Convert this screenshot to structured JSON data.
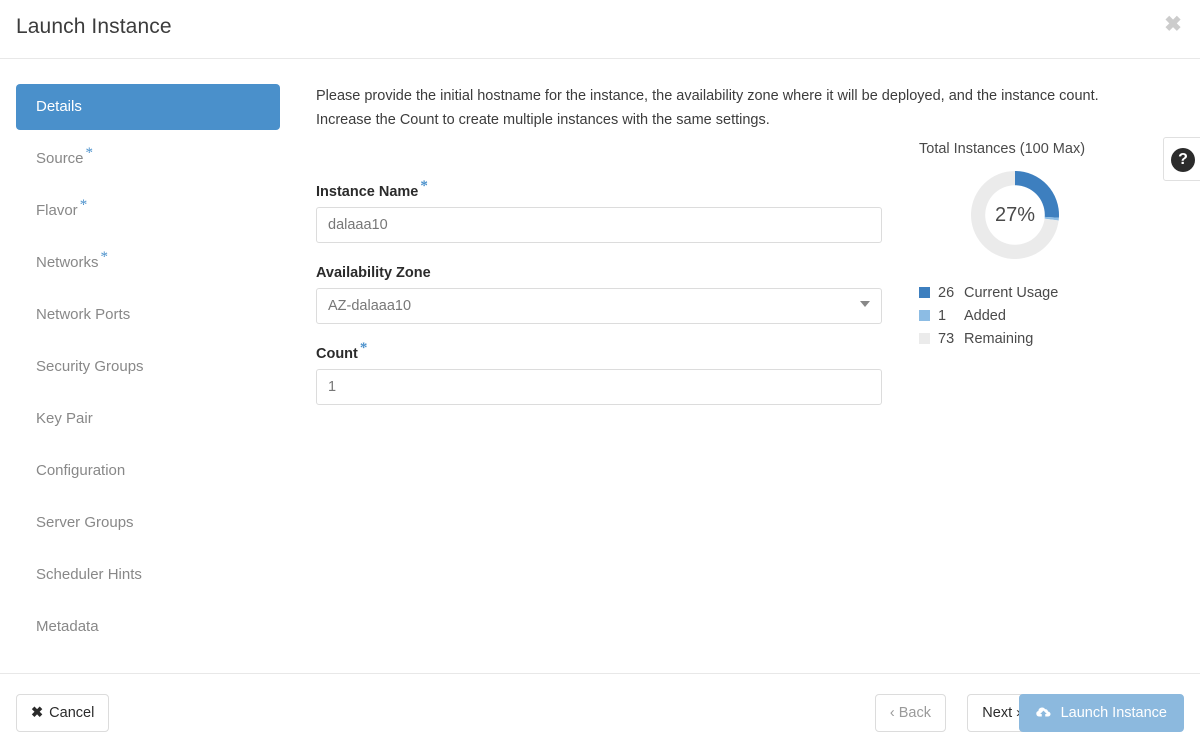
{
  "header": {
    "title": "Launch Instance",
    "close_icon": "close-icon"
  },
  "sidebar": {
    "items": [
      {
        "label": "Details",
        "required": false,
        "active": true
      },
      {
        "label": "Source",
        "required": true,
        "active": false
      },
      {
        "label": "Flavor",
        "required": true,
        "active": false
      },
      {
        "label": "Networks",
        "required": true,
        "active": false
      },
      {
        "label": "Network Ports",
        "required": false,
        "active": false
      },
      {
        "label": "Security Groups",
        "required": false,
        "active": false
      },
      {
        "label": "Key Pair",
        "required": false,
        "active": false
      },
      {
        "label": "Configuration",
        "required": false,
        "active": false
      },
      {
        "label": "Server Groups",
        "required": false,
        "active": false
      },
      {
        "label": "Scheduler Hints",
        "required": false,
        "active": false
      },
      {
        "label": "Metadata",
        "required": false,
        "active": false
      }
    ]
  },
  "main": {
    "description": "Please provide the initial hostname for the instance, the availability zone where it will be deployed, and the instance count. Increase the Count to create multiple instances with the same settings.",
    "fields": {
      "instance_name": {
        "label": "Instance Name",
        "required": true,
        "value": "dalaaa10",
        "placeholder": ""
      },
      "availability_zone": {
        "label": "Availability Zone",
        "required": false,
        "value": "AZ-dalaaa10",
        "options": [
          "AZ-dalaaa10"
        ],
        "caret_icon": "chevron-down-icon"
      },
      "count": {
        "label": "Count",
        "required": true,
        "value": "1",
        "placeholder": ""
      }
    },
    "help_button": {
      "icon": "question-mark-circle-icon",
      "glyph": "?"
    }
  },
  "quota": {
    "title": "Total Instances (100 Max)",
    "center_label": "27%"
  },
  "chart_data": {
    "type": "pie",
    "title": "Total Instances (100 Max)",
    "center_label": "27%",
    "max": 100,
    "categories": [
      "Current Usage",
      "Added",
      "Remaining"
    ],
    "values": [
      26,
      1,
      73
    ],
    "colors": [
      "#3d7fbf",
      "#8cbce4",
      "#ebebeb"
    ],
    "legend": [
      {
        "value": "26",
        "label": "Current Usage",
        "color": "#3d7fbf"
      },
      {
        "value": "1",
        "label": "Added",
        "color": "#8cbce4"
      },
      {
        "value": "73",
        "label": "Remaining",
        "color": "#ebebeb"
      }
    ],
    "legend_position": "bottom-left",
    "grid": false,
    "start_angle": -90,
    "donut_hole_ratio": 0.62
  },
  "footer": {
    "cancel": {
      "label": "Cancel",
      "icon": "times-icon",
      "glyph": "✖"
    },
    "back": {
      "label": "Back",
      "icon": "chevron-left-icon",
      "glyph": "‹",
      "disabled": true
    },
    "next": {
      "label": "Next",
      "icon": "chevron-right-icon",
      "glyph": "›"
    },
    "launch": {
      "label": "Launch Instance",
      "icon": "cloud-upload-icon",
      "glyph": "☁",
      "disabled": true
    }
  },
  "theme": {
    "accent": "#4a90cb",
    "accent_dark": "#3d7fbf",
    "accent_light": "#8cbce4",
    "muted": "#ebebeb",
    "launch_bg": "#8cb9de"
  }
}
